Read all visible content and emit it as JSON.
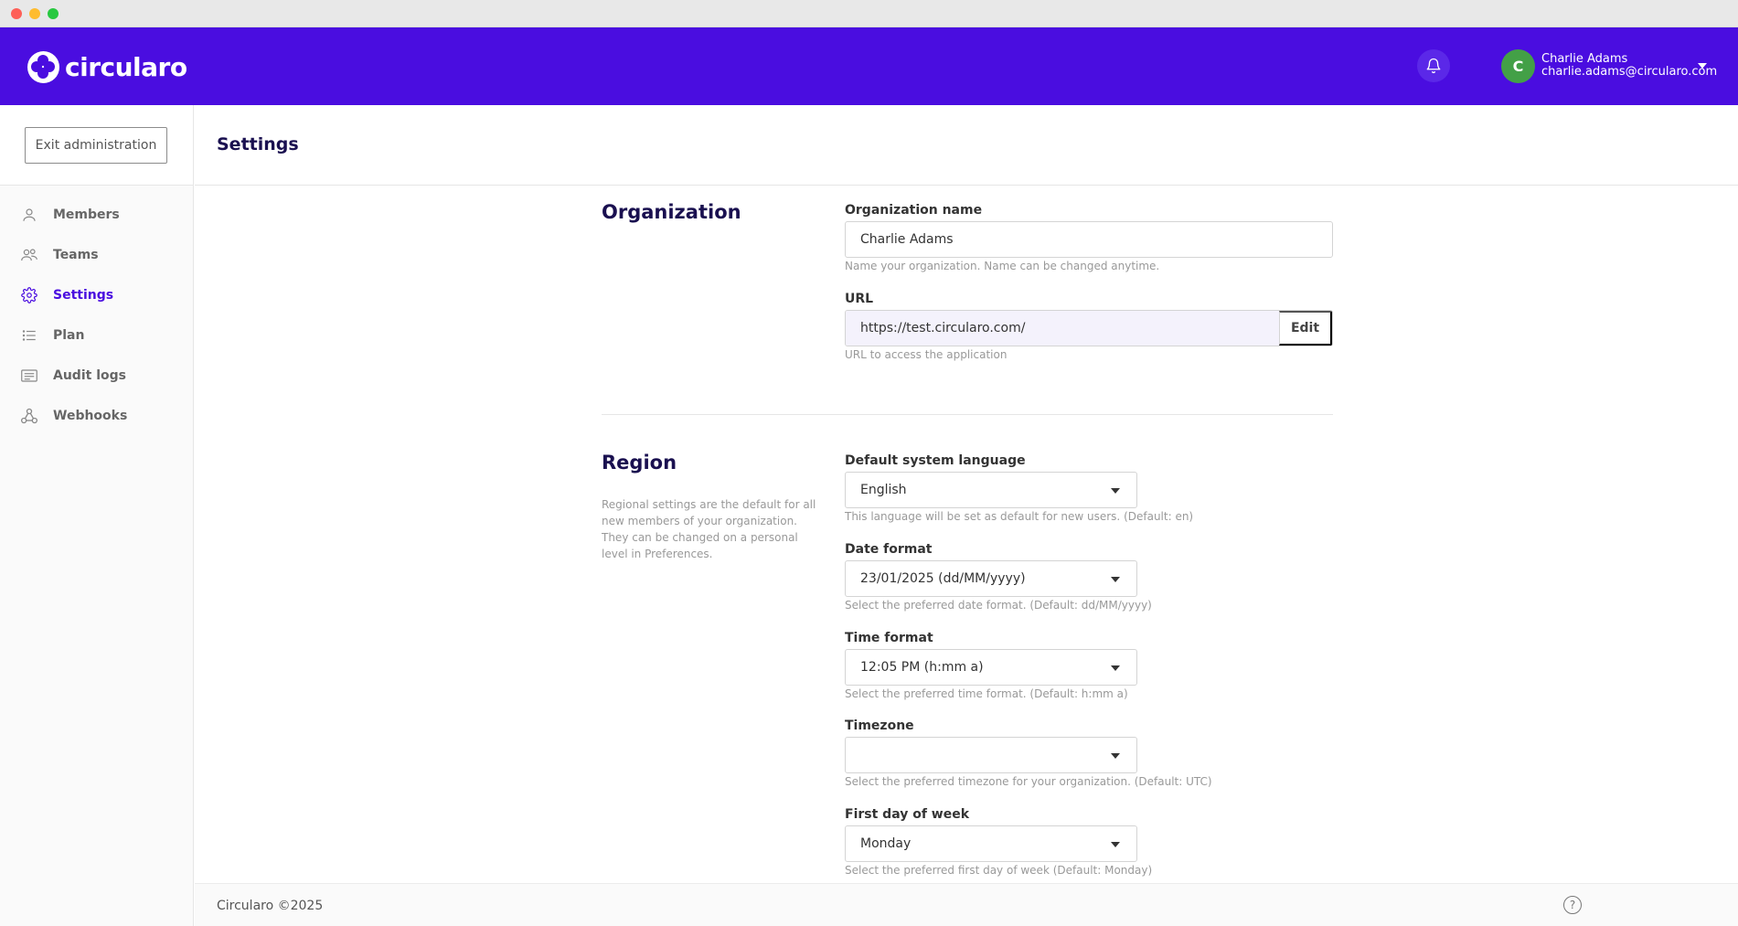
{
  "app": {
    "brand": "circularo"
  },
  "header": {
    "user_initial": "C",
    "user_name": "Charlie Adams",
    "user_email": "charlie.adams@circularo.com"
  },
  "sidebar": {
    "exit_label": "Exit administration",
    "items": [
      {
        "label": "Members",
        "icon": "person-icon"
      },
      {
        "label": "Teams",
        "icon": "people-icon"
      },
      {
        "label": "Settings",
        "icon": "gear-icon",
        "active": true
      },
      {
        "label": "Plan",
        "icon": "list-icon"
      },
      {
        "label": "Audit logs",
        "icon": "log-icon"
      },
      {
        "label": "Webhooks",
        "icon": "webhook-icon"
      }
    ]
  },
  "page": {
    "title": "Settings"
  },
  "organization": {
    "title": "Organization",
    "name_label": "Organization name",
    "name_value": "Charlie Adams",
    "name_hint": "Name your organization. Name can be changed anytime.",
    "url_label": "URL",
    "url_value": "https://test.circularo.com/",
    "url_edit": "Edit",
    "url_hint": "URL to access the application"
  },
  "region": {
    "title": "Region",
    "description": "Regional settings are the default for all new members of your organization. They can be changed on a personal level in Preferences.",
    "language_label": "Default system language",
    "language_value": "English",
    "language_hint": "This language will be set as default for new users.  (Default: en)",
    "date_label": "Date format",
    "date_value": "23/01/2025 (dd/MM/yyyy)",
    "date_hint": "Select the preferred date format.  (Default: dd/MM/yyyy)",
    "time_label": "Time format",
    "time_value": "12:05 PM (h:mm a)",
    "time_hint": "Select the preferred time format.  (Default: h:mm a)",
    "timezone_label": "Timezone",
    "timezone_value": "",
    "timezone_hint": "Select the preferred timezone for your organization.  (Default: UTC)",
    "week_label": "First day of week",
    "week_value": "Monday",
    "week_hint": "Select the preferred first day of week  (Default: Monday)"
  },
  "footer": {
    "copyright": "Circularo ©2025"
  },
  "colors": {
    "brand": "#4a0de0",
    "avatar": "#43a047",
    "title": "#1a1050"
  }
}
